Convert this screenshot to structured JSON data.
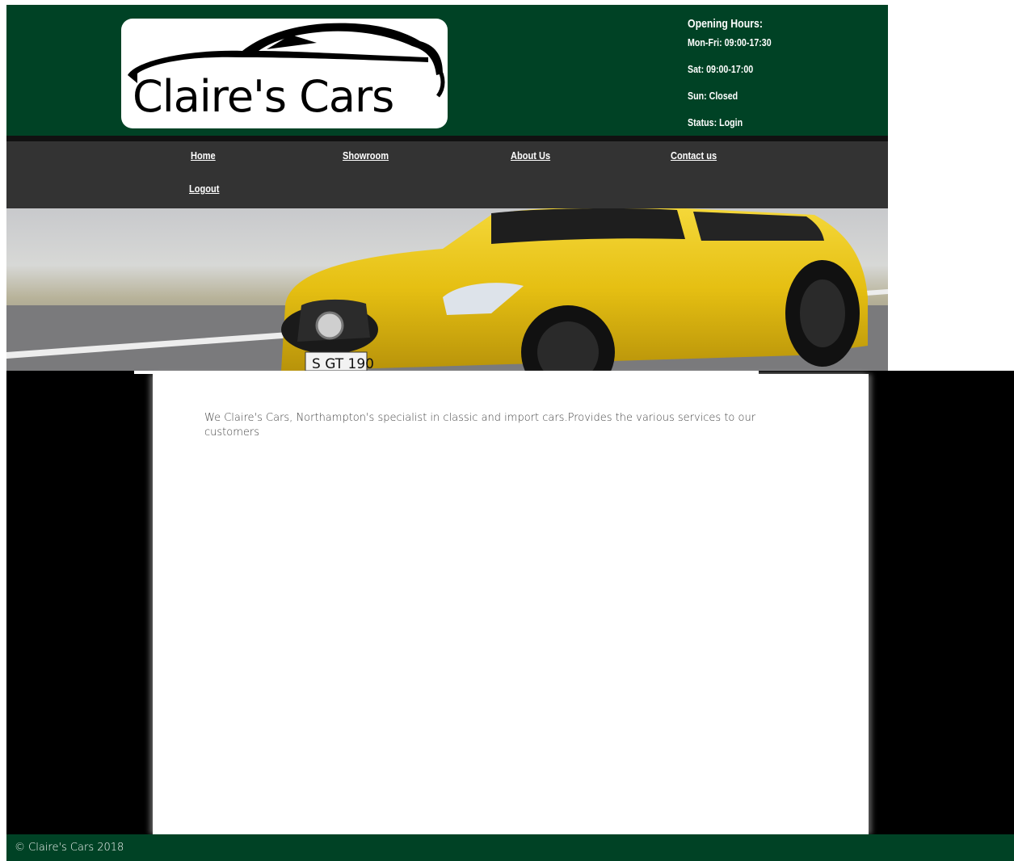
{
  "header": {
    "logo_text": "Claire's Cars",
    "opening_hours": {
      "title": "Opening Hours:",
      "lines": [
        "Mon-Fri: 09:00-17:30",
        "Sat: 09:00-17:00",
        "Sun: Closed",
        "Status: Login"
      ]
    }
  },
  "nav": {
    "items": [
      {
        "label": "Home"
      },
      {
        "label": "Showroom"
      },
      {
        "label": "About Us"
      },
      {
        "label": "Contact us"
      },
      {
        "label": "Logout"
      }
    ]
  },
  "banner": {
    "plate_text": "S GT 190"
  },
  "main": {
    "intro_text": "We Claire's Cars, Northampton's specialist in classic and import cars.Provides the various services to our customers"
  },
  "footer": {
    "copyright": "© Claire's Cars 2018"
  },
  "colors": {
    "header_green": "#004225",
    "nav_gray": "#333333",
    "stage_black": "#000000",
    "car_yellow": "#e8c21a"
  }
}
